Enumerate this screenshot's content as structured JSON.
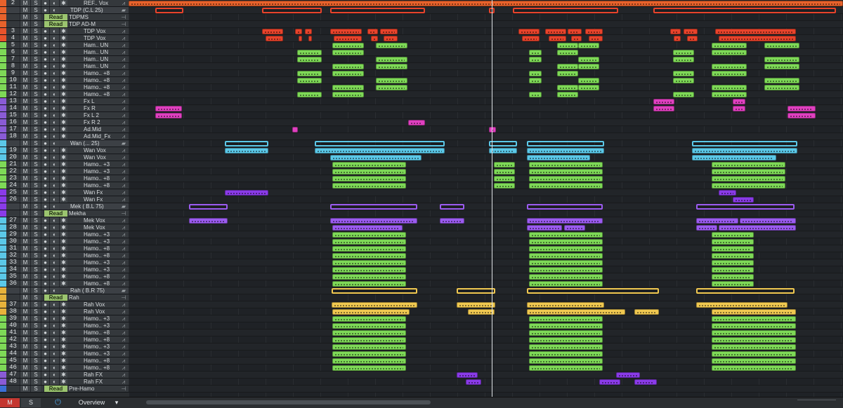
{
  "tracks": [
    {
      "num": "2",
      "name": "REF.. Vox",
      "color": "#e8622b"
    },
    {
      "num": "",
      "name": "TDP (C.L 25)",
      "color": "#e8622b",
      "folder": true
    },
    {
      "num": "",
      "name": "TDPMS",
      "color": "#e8622b",
      "read": "Read"
    },
    {
      "num": "",
      "name": "TDP AD-M",
      "color": "#e8622b",
      "read": "Read"
    },
    {
      "num": "3",
      "name": "TDP Vox",
      "color": "#e8532b"
    },
    {
      "num": "4",
      "name": "TDP Vox",
      "color": "#e8532b"
    },
    {
      "num": "5",
      "name": "Ham.. UN",
      "color": "#7ed957"
    },
    {
      "num": "6",
      "name": "Ham.. UN",
      "color": "#7ed957"
    },
    {
      "num": "7",
      "name": "Ham.. UN",
      "color": "#7ed957"
    },
    {
      "num": "8",
      "name": "Ham.. UN",
      "color": "#7ed957"
    },
    {
      "num": "9",
      "name": "Hamo.. +8",
      "color": "#7ed957"
    },
    {
      "num": "10",
      "name": "Hamo.. +8",
      "color": "#7ed957"
    },
    {
      "num": "11",
      "name": "Hamo.. +8",
      "color": "#7ed957"
    },
    {
      "num": "12",
      "name": "Hamo.. +8",
      "color": "#7ed957"
    },
    {
      "num": "13",
      "name": "Fx L",
      "color": "#8a5bd6"
    },
    {
      "num": "14",
      "name": "Fx R",
      "color": "#8a5bd6"
    },
    {
      "num": "15",
      "name": "Fx L 2",
      "color": "#8a5bd6"
    },
    {
      "num": "16",
      "name": "Fx R 2",
      "color": "#8a5bd6"
    },
    {
      "num": "17",
      "name": "Ad.Mid",
      "color": "#8a5bd6"
    },
    {
      "num": "18",
      "name": "Ad.Mid_Fx",
      "color": "#8a5bd6"
    },
    {
      "num": "",
      "name": "Wan (... 25)",
      "color": "#5bc8e8",
      "folder": true
    },
    {
      "num": "19",
      "name": "Wan Vox",
      "color": "#5bc8e8"
    },
    {
      "num": "20",
      "name": "Wan Vox",
      "color": "#5bc8e8"
    },
    {
      "num": "21",
      "name": "Hamo.. +3",
      "color": "#7ed957"
    },
    {
      "num": "22",
      "name": "Hamo.. +3",
      "color": "#7ed957"
    },
    {
      "num": "23",
      "name": "Hamo.. +8",
      "color": "#7ed957"
    },
    {
      "num": "24",
      "name": "Hamo.. +8",
      "color": "#7ed957"
    },
    {
      "num": "25",
      "name": "Wan Fx",
      "color": "#8a3be8"
    },
    {
      "num": "26",
      "name": "Wan Fx",
      "color": "#8a3be8"
    },
    {
      "num": "",
      "name": "Mek ( B.L 75)",
      "color": "#8a3be8",
      "folder": true
    },
    {
      "num": "",
      "name": "Mekha",
      "color": "#8a3be8",
      "read": "Read"
    },
    {
      "num": "27",
      "name": "Mek Vox",
      "color": "#5bc8e8"
    },
    {
      "num": "28",
      "name": "Mek Vox",
      "color": "#5bc8e8"
    },
    {
      "num": "29",
      "name": "Hamo.. +3",
      "color": "#5bc8e8"
    },
    {
      "num": "30",
      "name": "Hamo.. +3",
      "color": "#5bc8e8"
    },
    {
      "num": "31",
      "name": "Hamo.. +8",
      "color": "#5bc8e8"
    },
    {
      "num": "32",
      "name": "Hamo.. +8",
      "color": "#5bc8e8"
    },
    {
      "num": "33",
      "name": "Hamo.. +3",
      "color": "#5bc8e8"
    },
    {
      "num": "34",
      "name": "Hamo.. +3",
      "color": "#5bc8e8"
    },
    {
      "num": "35",
      "name": "Hamo.. +8",
      "color": "#5bc8e8"
    },
    {
      "num": "36",
      "name": "Hamo.. +8",
      "color": "#5bc8e8"
    },
    {
      "num": "",
      "name": "Rah ( B.R 75)",
      "color": "#e8b23b",
      "folder": true
    },
    {
      "num": "",
      "name": "Rah",
      "color": "#e8b23b",
      "read": "Read"
    },
    {
      "num": "37",
      "name": "Rah Vox",
      "color": "#e8b23b"
    },
    {
      "num": "38",
      "name": "Rah Vox",
      "color": "#e8b23b"
    },
    {
      "num": "39",
      "name": "Hamo.. +3",
      "color": "#7ed957"
    },
    {
      "num": "40",
      "name": "Hamo.. +3",
      "color": "#7ed957"
    },
    {
      "num": "41",
      "name": "Hamo.. +8",
      "color": "#7ed957"
    },
    {
      "num": "42",
      "name": "Hamo.. +8",
      "color": "#7ed957"
    },
    {
      "num": "43",
      "name": "Hamo.. +3",
      "color": "#7ed957"
    },
    {
      "num": "44",
      "name": "Hamo.. +3",
      "color": "#7ed957"
    },
    {
      "num": "45",
      "name": "Hamo.. +8",
      "color": "#7ed957"
    },
    {
      "num": "46",
      "name": "Hamo.. +8",
      "color": "#7ed957"
    },
    {
      "num": "47",
      "name": "Rah FX",
      "color": "#8a5bd6"
    },
    {
      "num": "48",
      "name": "Rah FX",
      "color": "#8a5bd6"
    },
    {
      "num": "",
      "name": "Pre-Hamo",
      "color": "#3b6fd6",
      "read": "Read"
    }
  ],
  "labels": {
    "mute": "M",
    "solo": "S",
    "dot": "●",
    "rec": "◐",
    "star": "✱",
    "wave": "⩘",
    "folder": "▰",
    "arrow": "⊣"
  },
  "bottom": {
    "mute": "M",
    "solo": "S",
    "power": "⏻",
    "overview": "Overview",
    "ov_arrow": "▾"
  },
  "colors": {
    "orange": "#e8622b",
    "red": "#e8432b",
    "green": "#7ed957",
    "pink": "#e040c0",
    "cyan": "#5bc8e8",
    "purple": "#8a3be8",
    "yellow": "#f0c850",
    "violet": "#9b5bf0"
  }
}
